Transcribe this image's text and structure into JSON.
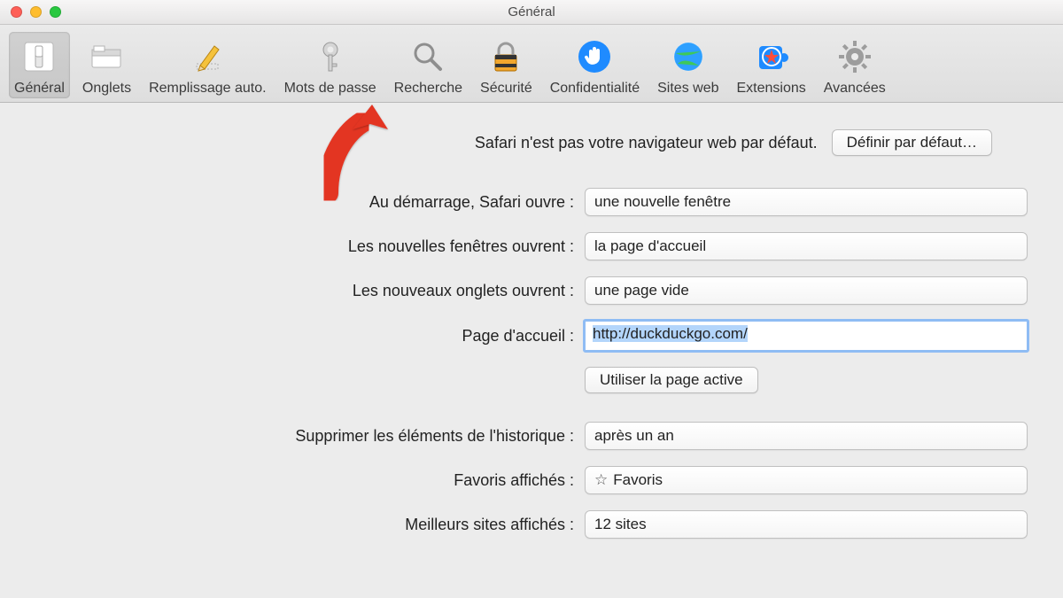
{
  "window": {
    "title": "Général"
  },
  "toolbar": [
    {
      "id": "general",
      "label": "Général",
      "selected": true
    },
    {
      "id": "tabs",
      "label": "Onglets",
      "selected": false
    },
    {
      "id": "autofill",
      "label": "Remplissage auto.",
      "selected": false
    },
    {
      "id": "passwords",
      "label": "Mots de passe",
      "selected": false
    },
    {
      "id": "search",
      "label": "Recherche",
      "selected": false
    },
    {
      "id": "security",
      "label": "Sécurité",
      "selected": false
    },
    {
      "id": "privacy",
      "label": "Confidentialité",
      "selected": false
    },
    {
      "id": "websites",
      "label": "Sites web",
      "selected": false
    },
    {
      "id": "extensions",
      "label": "Extensions",
      "selected": false
    },
    {
      "id": "advanced",
      "label": "Avancées",
      "selected": false
    }
  ],
  "banner": {
    "text": "Safari n'est pas votre navigateur web par défaut.",
    "button": "Définir par défaut…"
  },
  "form": {
    "startup": {
      "label": "Au démarrage, Safari ouvre :",
      "value": "une nouvelle fenêtre"
    },
    "new_windows": {
      "label": "Les nouvelles fenêtres ouvrent :",
      "value": "la page d'accueil"
    },
    "new_tabs": {
      "label": "Les nouveaux onglets ouvrent :",
      "value": "une page vide"
    },
    "homepage": {
      "label": "Page d'accueil :",
      "value": "http://duckduckgo.com/"
    },
    "use_current": {
      "button": "Utiliser la page active"
    },
    "history": {
      "label": "Supprimer les éléments de l'historique :",
      "value": "après un an"
    },
    "favorites": {
      "label": "Favoris affichés :",
      "value": "Favoris"
    },
    "topsites": {
      "label": "Meilleurs sites affichés :",
      "value": "12 sites"
    }
  }
}
